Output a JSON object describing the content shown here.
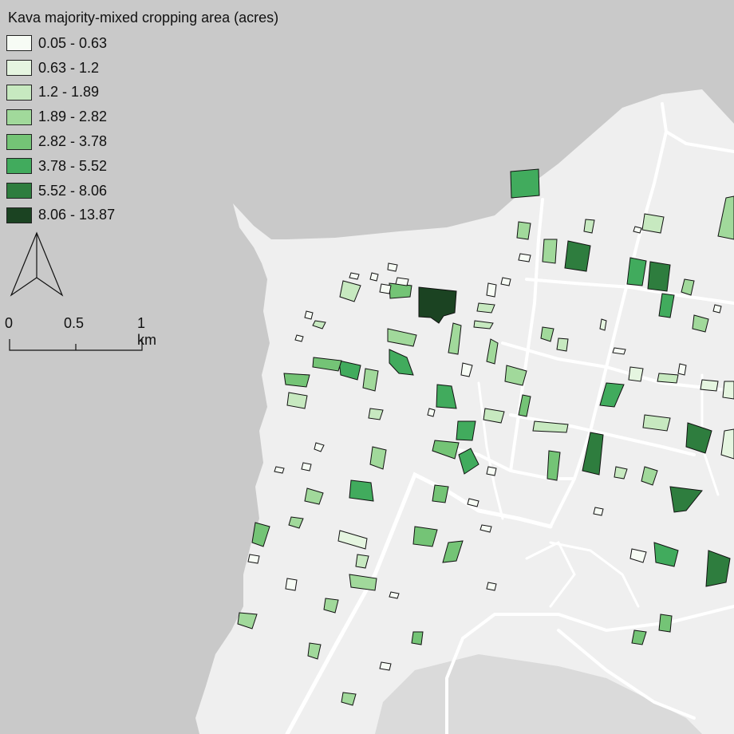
{
  "legend": {
    "title": "Kava majority-mixed cropping area (acres)",
    "classes": [
      {
        "label": "0.05 - 0.63",
        "color": "#f7fcf5"
      },
      {
        "label": "0.63 - 1.2",
        "color": "#e5f5e0"
      },
      {
        "label": "1.2 - 1.89",
        "color": "#c7e9c0"
      },
      {
        "label": "1.89 - 2.82",
        "color": "#a1d99b"
      },
      {
        "label": "2.82 - 3.78",
        "color": "#74c476"
      },
      {
        "label": "3.78 - 5.52",
        "color": "#41ab5d"
      },
      {
        "label": "5.52 - 8.06",
        "color": "#2e7d3e"
      },
      {
        "label": "8.06 - 13.87",
        "color": "#1b4322"
      }
    ]
  },
  "scale_bar": {
    "labels": [
      "0",
      "0.5",
      "1 km"
    ]
  },
  "north_arrow": {
    "icon": "north-arrow-icon"
  },
  "colors": {
    "sea": "#c9c9c9",
    "land": "#efefef",
    "road": "#ffffff",
    "outline": "#111111"
  }
}
